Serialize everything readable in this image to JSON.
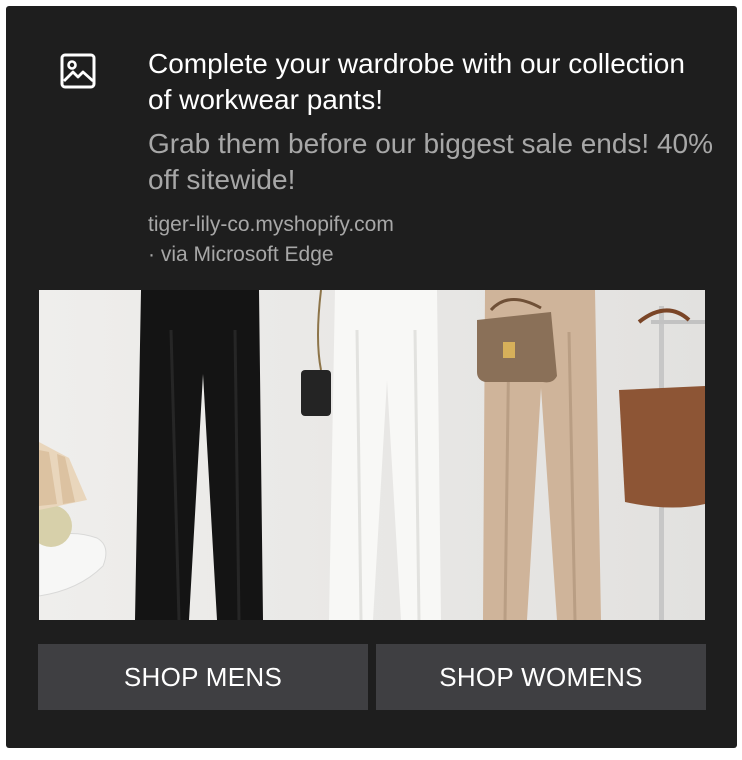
{
  "notification": {
    "title": "Complete your wardrobe with our collection of workwear pants!",
    "message": "Grab them before our biggest sale ends! 40% off sitewide!",
    "domain": "tiger-lily-co.myshopify.com",
    "via": "· via Microsoft Edge",
    "icon": "image-icon",
    "image": {
      "icon": "product-photo",
      "description_items": [
        "black-trousers",
        "white-trousers",
        "beige-trousers",
        "table-lamp",
        "handbags"
      ]
    },
    "actions": [
      {
        "label": "SHOP MENS"
      },
      {
        "label": "SHOP WOMENS"
      }
    ]
  },
  "colors": {
    "background": "#1e1e1e",
    "button": "#3f3f42",
    "text_primary": "#ffffff",
    "text_secondary": "#a7a7a7"
  }
}
